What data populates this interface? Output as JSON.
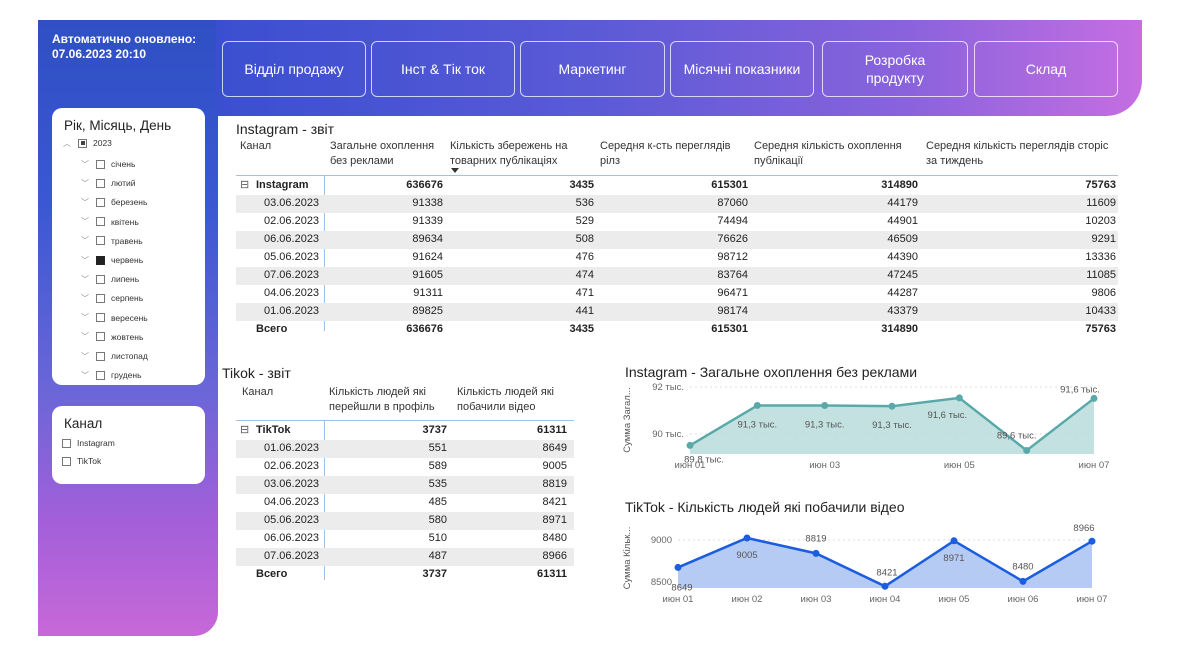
{
  "header": {
    "update_label": "Автоматично оновлено: 07.06.2023 20:10",
    "nav": [
      {
        "label": "Відділ продажу"
      },
      {
        "label": "Інст & Тік ток"
      },
      {
        "label": "Маркетинг"
      },
      {
        "label": "Місячні показники"
      },
      {
        "label": "Розробка продукту"
      },
      {
        "label": "Склад"
      }
    ]
  },
  "date_slicer": {
    "title": "Рік, Місяць, День",
    "year": "2023",
    "months": [
      "січень",
      "лютий",
      "березень",
      "квітень",
      "травень",
      "червень",
      "липень",
      "серпень",
      "вересень",
      "жовтень",
      "листопад",
      "грудень"
    ],
    "selected_month": "червень"
  },
  "channel_slicer": {
    "title": "Канал",
    "options": [
      "Instagram",
      "TikTok"
    ]
  },
  "instagram_table": {
    "title": "Instagram - звіт",
    "headers": [
      "Канал",
      "Загальне охоплення без реклами",
      "Кількість збережень на товарних публікаціях",
      "Середня к-сть переглядів рілз",
      "Середня кількість охоплення публікації",
      "Середня кількість переглядів сторіс за тиждень"
    ],
    "group_label": "Instagram",
    "group_values": [
      "636676",
      "3435",
      "615301",
      "314890",
      "75763"
    ],
    "rows": [
      [
        "03.06.2023",
        "91338",
        "536",
        "87060",
        "44179",
        "11609"
      ],
      [
        "02.06.2023",
        "91339",
        "529",
        "74494",
        "44901",
        "10203"
      ],
      [
        "06.06.2023",
        "89634",
        "508",
        "76626",
        "46509",
        "9291"
      ],
      [
        "05.06.2023",
        "91624",
        "476",
        "98712",
        "44390",
        "13336"
      ],
      [
        "07.06.2023",
        "91605",
        "474",
        "83764",
        "47245",
        "11085"
      ],
      [
        "04.06.2023",
        "91311",
        "471",
        "96471",
        "44287",
        "9806"
      ],
      [
        "01.06.2023",
        "89825",
        "441",
        "98174",
        "43379",
        "10433"
      ]
    ],
    "total_label": "Всего",
    "total_values": [
      "636676",
      "3435",
      "615301",
      "314890",
      "75763"
    ]
  },
  "tiktok_table": {
    "title": "Tikok - звіт",
    "headers": [
      "Канал",
      "Кількість людей які перейшли в профіль",
      "Кількість людей які побачили відео"
    ],
    "group_label": "TikTok",
    "group_values": [
      "3737",
      "61311"
    ],
    "rows": [
      [
        "01.06.2023",
        "551",
        "8649"
      ],
      [
        "02.06.2023",
        "589",
        "9005"
      ],
      [
        "03.06.2023",
        "535",
        "8819"
      ],
      [
        "04.06.2023",
        "485",
        "8421"
      ],
      [
        "05.06.2023",
        "580",
        "8971"
      ],
      [
        "06.06.2023",
        "510",
        "8480"
      ],
      [
        "07.06.2023",
        "487",
        "8966"
      ]
    ],
    "total_label": "Всего",
    "total_values": [
      "3737",
      "61311"
    ]
  },
  "chart_data": [
    {
      "type": "area",
      "title": "Instagram - Загальне охоплення без реклами",
      "ylabel": "Сумма Загал...",
      "x": [
        "июн 01",
        "июн 02",
        "июн 03",
        "июн 04",
        "июн 05",
        "июн 06",
        "июн 07"
      ],
      "x_tick_labels": [
        "июн 01",
        "июн 03",
        "июн 05",
        "июн 07"
      ],
      "y_tick_labels": [
        "92 тыс.",
        "90 тыс."
      ],
      "ylim": [
        89500,
        92000
      ],
      "values": [
        89825,
        91339,
        91338,
        91311,
        91624,
        89634,
        91605
      ],
      "data_labels": [
        "89,8 тыс.",
        "91,3 тыс.",
        "91,3 тыс.",
        "91,3 тыс.",
        "91,6 тыс.",
        "89,6 тыс.",
        "91,6 тыс."
      ],
      "color": "#5aa9aa",
      "fill": "#b9dcdc"
    },
    {
      "type": "area",
      "title": "TikTok - Кількість людей які побачили відео",
      "ylabel": "Сумма Кільк...",
      "x": [
        "июн 01",
        "июн 02",
        "июн 03",
        "июн 04",
        "июн 05",
        "июн 06",
        "июн 07"
      ],
      "x_tick_labels": [
        "июн 01",
        "июн 02",
        "июн 03",
        "июн 04",
        "июн 05",
        "июн 06",
        "июн 07"
      ],
      "y_tick_labels": [
        "9000",
        "8500"
      ],
      "ylim": [
        8400,
        9150
      ],
      "values": [
        8649,
        9005,
        8819,
        8421,
        8971,
        8480,
        8966
      ],
      "data_labels": [
        "8649",
        "9005",
        "8819",
        "8421",
        "8971",
        "8480",
        "8966"
      ],
      "color": "#1a5de0",
      "fill": "#a9c2f2"
    }
  ]
}
